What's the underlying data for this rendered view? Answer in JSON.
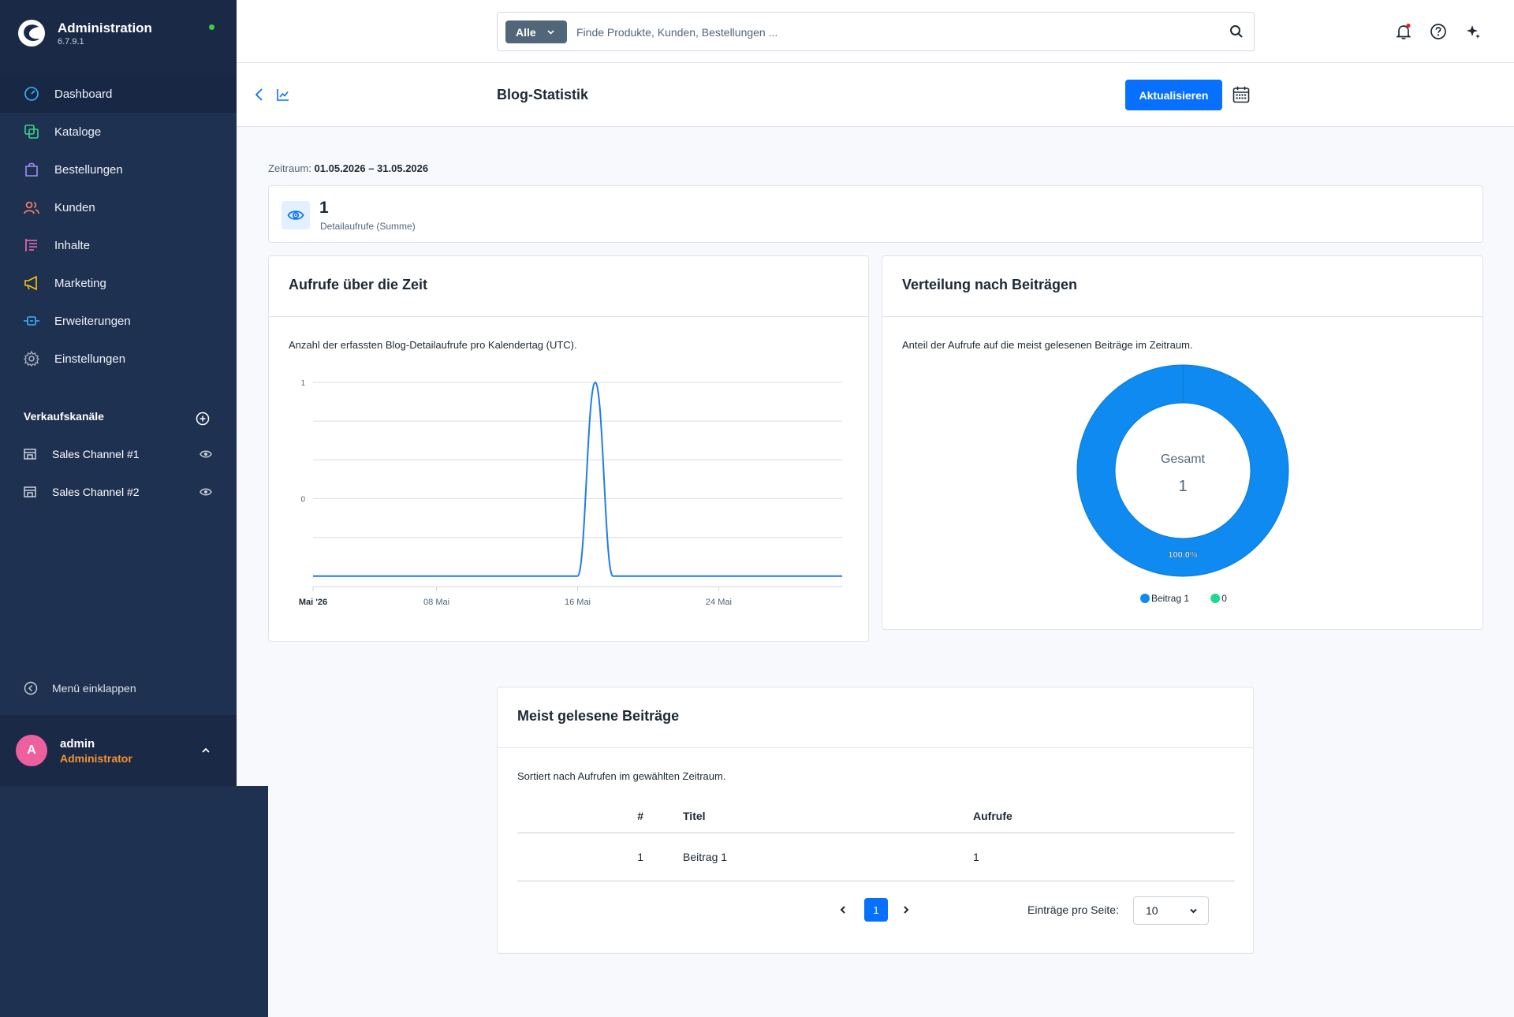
{
  "app": {
    "title": "Administration",
    "version": "6.7.9.1"
  },
  "sidebar": {
    "items": [
      {
        "label": "Dashboard",
        "icon": "dashboard-icon",
        "color": "#3ab4ff"
      },
      {
        "label": "Kataloge",
        "icon": "catalog-icon",
        "color": "#3ad68c"
      },
      {
        "label": "Bestellungen",
        "icon": "shopping-bag-icon",
        "color": "#a58cf5"
      },
      {
        "label": "Kunden",
        "icon": "customers-icon",
        "color": "#ff8a65"
      },
      {
        "label": "Inhalte",
        "icon": "content-icon",
        "color": "#f06ab8"
      },
      {
        "label": "Marketing",
        "icon": "megaphone-icon",
        "color": "#ffc400"
      },
      {
        "label": "Erweiterungen",
        "icon": "plug-icon",
        "color": "#3ab4ff"
      },
      {
        "label": "Einstellungen",
        "icon": "gear-icon",
        "color": "#a8b3c3"
      }
    ],
    "sales_channels_heading": "Verkaufskanäle",
    "sales_channels": [
      {
        "label": "Sales Channel #1"
      },
      {
        "label": "Sales Channel #2"
      }
    ],
    "collapse_label": "Menü einklappen"
  },
  "user": {
    "initial": "A",
    "name": "admin",
    "role": "Administrator"
  },
  "search": {
    "type_label": "Alle",
    "placeholder": "Finde Produkte, Kunden, Bestellungen ..."
  },
  "page": {
    "title": "Blog-Statistik",
    "refresh_label": "Aktualisieren",
    "period_label": "Zeitraum:",
    "period_value": "01.05.2026 – 31.05.2026"
  },
  "kpi": {
    "value": "1",
    "label": "Detailaufrufe (Summe)"
  },
  "line_card": {
    "title": "Aufrufe über die Zeit",
    "description": "Anzahl der erfassten Blog-Detailaufrufe pro Kalendertag (UTC)."
  },
  "pie_card": {
    "title": "Verteilung nach Beiträgen",
    "description": "Anteil der Aufrufe auf die meist gelesenen Beiträge im Zeitraum.",
    "center_label": "Gesamt",
    "center_value": "1",
    "slice_label": "100.0%"
  },
  "chart_data": [
    {
      "type": "line",
      "x": [
        "2026-05-01",
        "2026-05-02",
        "2026-05-03",
        "2026-05-04",
        "2026-05-05",
        "2026-05-06",
        "2026-05-07",
        "2026-05-08",
        "2026-05-09",
        "2026-05-10",
        "2026-05-11",
        "2026-05-12",
        "2026-05-13",
        "2026-05-14",
        "2026-05-15",
        "2026-05-16",
        "2026-05-17",
        "2026-05-18",
        "2026-05-19",
        "2026-05-20",
        "2026-05-21",
        "2026-05-22",
        "2026-05-23",
        "2026-05-24",
        "2026-05-25",
        "2026-05-26",
        "2026-05-27",
        "2026-05-28",
        "2026-05-29",
        "2026-05-30",
        "2026-05-31"
      ],
      "series": [
        {
          "values": [
            0,
            0,
            0,
            0,
            0,
            0,
            0,
            0,
            0,
            0,
            0,
            0,
            0,
            0,
            0,
            0,
            1,
            0,
            0,
            0,
            0,
            0,
            0,
            0,
            0,
            0,
            0,
            0,
            0,
            0,
            0
          ],
          "color": "#1f7bf0"
        }
      ],
      "x_ticks": [
        {
          "date": "2026-05-01",
          "label": "Mai '26",
          "bold": true
        },
        {
          "date": "2026-05-08",
          "label": "08 Mai"
        },
        {
          "date": "2026-05-16",
          "label": "16 Mai"
        },
        {
          "date": "2026-05-24",
          "label": "24 Mai"
        }
      ],
      "y_tick_labels": [
        {
          "value": 1,
          "label": "1"
        },
        {
          "value": 0.4,
          "label": "0"
        }
      ],
      "ylim": [
        -0.05,
        1
      ],
      "grid": true
    },
    {
      "type": "pie",
      "donut": true,
      "slices": [
        {
          "label": "Beitrag 1",
          "value": 1,
          "color": "#0f8af0"
        },
        {
          "label": "0",
          "value": 0,
          "color": "#1fd990"
        }
      ],
      "legend": "bottom"
    }
  ],
  "table": {
    "title": "Meist gelesene Beiträge",
    "description": "Sortiert nach Aufrufen im gewählten Zeitraum.",
    "headers": {
      "num": "#",
      "title": "Titel",
      "views": "Aufrufe"
    },
    "rows": [
      {
        "num": "1",
        "title": "Beitrag 1",
        "views": "1"
      }
    ],
    "pagination": {
      "current_page": "1",
      "per_page_label": "Einträge pro Seite:",
      "per_page_value": "10"
    }
  }
}
